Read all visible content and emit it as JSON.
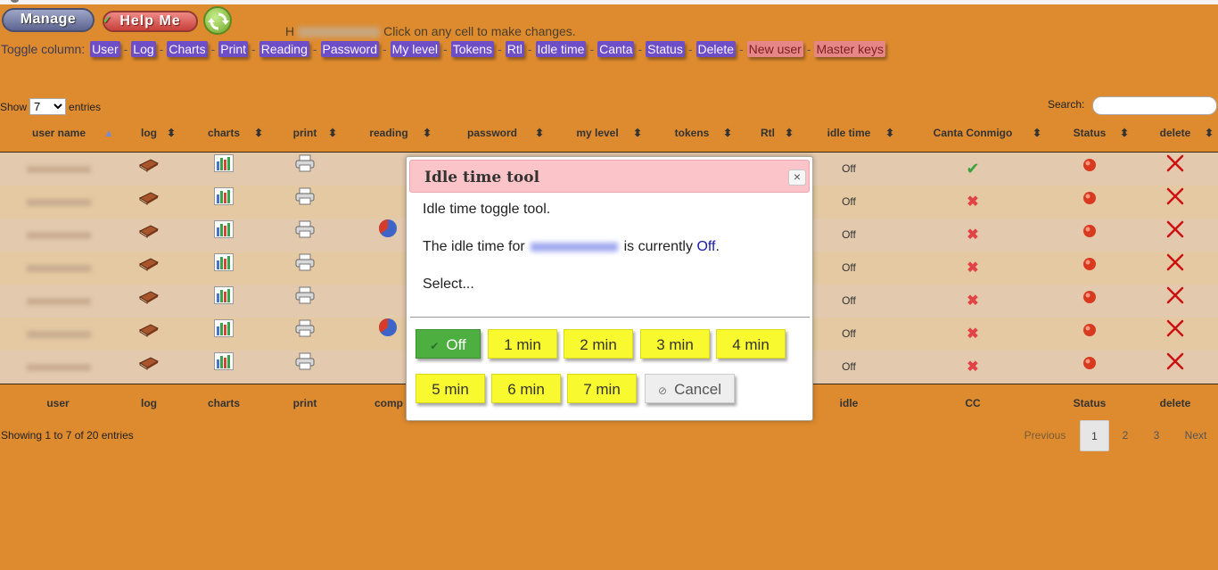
{
  "toolbar": {
    "manage_label": "Manage",
    "help_label": "Help Me",
    "refresh_icon": "refresh-icon",
    "hint_prefix": "H",
    "hint_text": "Click on any cell to make changes."
  },
  "toggle_columns": {
    "label": "Toggle column:",
    "items": [
      "User",
      "Log",
      "Charts",
      "Print",
      "Reading",
      "Password",
      "My level",
      "Tokens",
      "Rtl",
      "Idle time",
      "Canta",
      "Status",
      "Delete"
    ],
    "extra": [
      "New user",
      "Master keys"
    ]
  },
  "length": {
    "show_label": "Show",
    "value": "7",
    "entries_label": "entries"
  },
  "search": {
    "label": "Search:",
    "placeholder": ""
  },
  "table": {
    "headers": [
      "user name",
      "log",
      "charts",
      "print",
      "reading",
      "password",
      "my level",
      "tokens",
      "Rtl",
      "idle time",
      "Canta Conmigo",
      "Status",
      "delete"
    ],
    "footers": [
      "user",
      "log",
      "charts",
      "print",
      "comp",
      "idle",
      "CC",
      "Status",
      "delete"
    ],
    "rows": [
      {
        "idle": "Off",
        "canta": "check",
        "reading": ""
      },
      {
        "idle": "Off",
        "canta": "cross",
        "reading": ""
      },
      {
        "idle": "Off",
        "canta": "cross",
        "reading": "pie"
      },
      {
        "idle": "Off",
        "canta": "cross",
        "reading": ""
      },
      {
        "idle": "Off",
        "canta": "cross",
        "reading": ""
      },
      {
        "idle": "Off",
        "canta": "cross",
        "reading": "pie"
      },
      {
        "idle": "Off",
        "canta": "cross",
        "reading": ""
      }
    ]
  },
  "info": "Showing 1 to 7 of 20 entries",
  "pagination": {
    "previous": "Previous",
    "pages": [
      "1",
      "2",
      "3"
    ],
    "next": "Next",
    "current": "1"
  },
  "modal": {
    "title": "Idle time tool",
    "close_glyph": "×",
    "line1": "Idle time toggle tool.",
    "line2_prefix": "The idle time for",
    "line2_middle": "is currently",
    "current_status": "Off",
    "line2_suffix": ".",
    "select_label": "Select...",
    "options_row1": [
      "Off",
      "1 min",
      "2 min",
      "3 min",
      "4 min"
    ],
    "options_row2": [
      "5 min",
      "6 min",
      "7 min"
    ],
    "cancel_label": "Cancel",
    "selected_option": "Off",
    "colors": {
      "header_bg": "#FBC4C8",
      "option_bg": "#F9F92F",
      "selected_bg": "#4CAF40"
    }
  }
}
